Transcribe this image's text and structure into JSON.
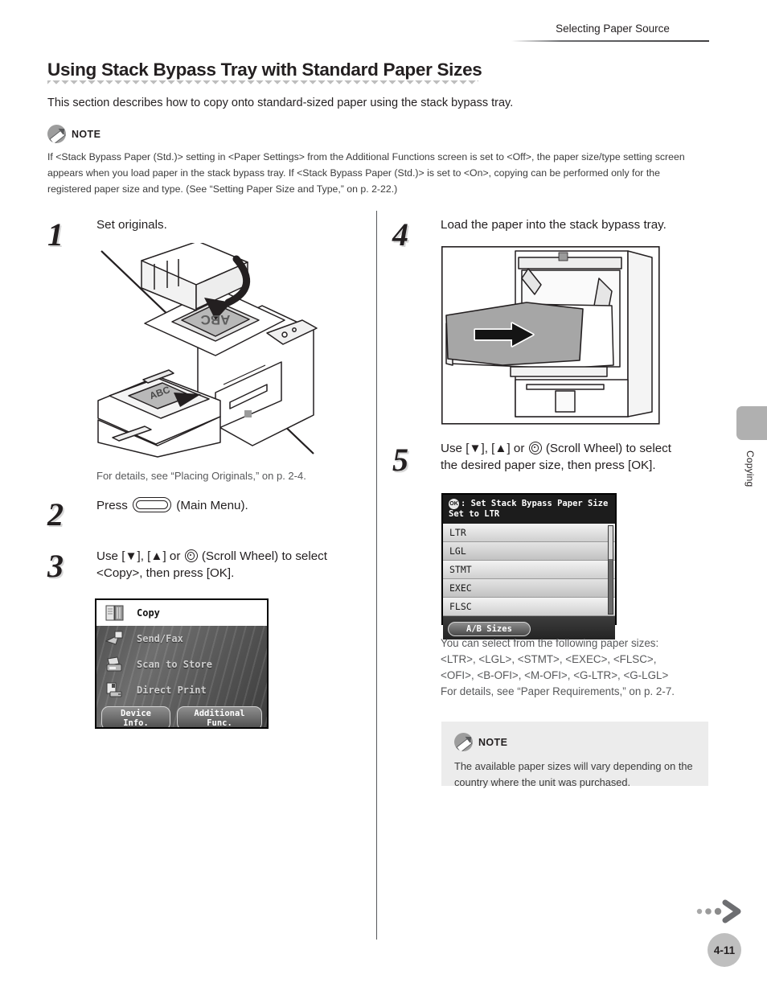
{
  "running_head": "Selecting Paper Source",
  "title": "Using Stack Bypass Tray with Standard Paper Sizes",
  "intro": "This section describes how to copy onto standard-sized paper using the stack bypass tray.",
  "note_top": {
    "label": "NOTE",
    "body": "If <Stack Bypass Paper (Std.)> setting in <Paper Settings> from the Additional Functions screen is set to <Off>, the paper size/type setting screen appears when you load paper in the stack bypass tray. If <Stack Bypass Paper (Std.)> is set to <On>, copying can be performed only for the registered paper size and type. (See “Setting Paper Size and Type,” on p. 2-22.)"
  },
  "steps": {
    "one": {
      "number": "1",
      "text": "Set originals.",
      "caption": "For details, see “Placing Originals,” on p. 2-4.",
      "illustration": "originals-placement-diagram"
    },
    "two": {
      "number": "2",
      "text_before": "Press",
      "text_after": "(Main Menu).",
      "key_icon": "main-menu-key-icon"
    },
    "three": {
      "number": "3",
      "line1_a": "Use [",
      "line1_down": "▼",
      "line1_b": "], [",
      "line1_up": "▲",
      "line1_c": "] or",
      "line1_d": "(Scroll Wheel) to select",
      "line2": "<Copy>, then press [OK]."
    },
    "four": {
      "number": "4",
      "text": "Load the paper into the stack bypass tray.",
      "illustration": "stack-bypass-tray-loading-diagram"
    },
    "five": {
      "number": "5",
      "line1_a": "Use [",
      "line1_down": "▼",
      "line1_b": "], [",
      "line1_up": "▲",
      "line1_c": "] or",
      "line1_d": "(Scroll Wheel) to select",
      "line2": "the desired paper size, then press [OK]."
    }
  },
  "main_menu_lcd": {
    "items": [
      {
        "label": "Copy",
        "icon": "copy-icon",
        "selected": true
      },
      {
        "label": "Send/Fax",
        "icon": "send-fax-icon",
        "selected": false
      },
      {
        "label": "Scan to Store",
        "icon": "scan-to-store-icon",
        "selected": false
      },
      {
        "label": "Direct Print",
        "icon": "direct-print-icon",
        "selected": false
      }
    ],
    "buttons": [
      "Device Info.",
      "Additional Func."
    ]
  },
  "paper_size_lcd": {
    "header_line1": ": Set Stack Bypass Paper Size",
    "header_line2": "Set to LTR",
    "ok_badge": "OK",
    "rows": [
      "LTR",
      "LGL",
      "STMT",
      "EXEC",
      "FLSC"
    ],
    "footer_button": "A/B Sizes"
  },
  "paper_sizes_text": {
    "line1": "You can select from the following paper sizes:",
    "line2": "<LTR>, <LGL>, <STMT>, <EXEC>, <FLSC>,",
    "line3": "<OFI>, <B-OFI>, <M-OFI>, <G-LTR>, <G-LGL>",
    "line4": "For details, see “Paper Requirements,” on p. 2-7."
  },
  "note_bottom": {
    "label": "NOTE",
    "body": "The available paper sizes will vary depending on the country where the unit was purchased."
  },
  "side_tab": {
    "label": "Copying"
  },
  "footer": {
    "page_number": "4-11"
  },
  "colors": {
    "text": "#231f20",
    "muted": "#58595b",
    "note_bg": "#ececec",
    "tab_gray": "#b0b0b0",
    "page_circle": "#bfbfbf"
  }
}
